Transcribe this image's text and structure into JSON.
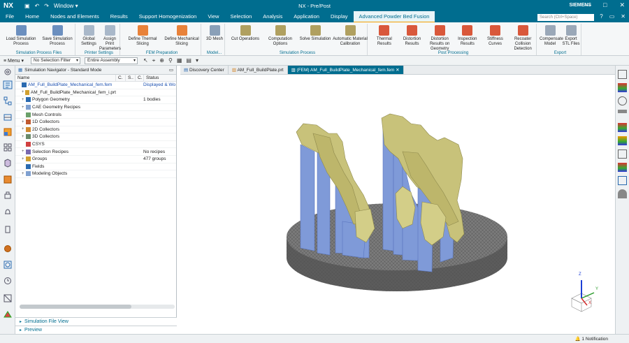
{
  "app": {
    "logo": "NX",
    "title": "NX - Pre/Post",
    "window_menu": "Window",
    "brand": "SIEMENS"
  },
  "menu": {
    "items": [
      "File",
      "Home",
      "Nodes and Elements",
      "Results",
      "Support Homogenization",
      "View",
      "Selection",
      "Analysis",
      "Application",
      "Display",
      "Advanced Powder Bed Fusion"
    ],
    "search_placeholder": "Search (Ctrl+Space)"
  },
  "ribbon": {
    "groups": [
      {
        "label": "Simulation Process Files",
        "buttons": [
          "Load Simulation Process",
          "Save Simulation Process"
        ]
      },
      {
        "label": "Printer Settings",
        "buttons": [
          "Global Settings",
          "Assign Print Parameters"
        ]
      },
      {
        "label": "FEM Preparation",
        "buttons": [
          "Define Thermal Slicing",
          "Define Mechanical Slicing"
        ]
      },
      {
        "label": "Model...",
        "buttons": [
          "3D Mesh"
        ]
      },
      {
        "label": "Simulation Process",
        "buttons": [
          "Cut Operations",
          "Computation Options",
          "Solve Simulation",
          "Automatic Material Calibration"
        ]
      },
      {
        "label": "Post Processing",
        "buttons": [
          "Thermal Results",
          "Distortion Results",
          "Distortion Results on Geometry",
          "Inspection Results",
          "Stiffness Curves",
          "Recoater Collision Detection"
        ]
      },
      {
        "label": "Export",
        "buttons": [
          "Compensate Model",
          "Export STL Files"
        ]
      }
    ]
  },
  "toolbar": {
    "menu_label": "Menu",
    "selection_filter": "No Selection Filter",
    "scope": "Entire Assembly"
  },
  "navigator": {
    "title": "Simulation Navigator - Standard Mode",
    "columns": {
      "name": "Name",
      "c1": "C.",
      "c2": "S..",
      "c3": "C.",
      "status": "Status"
    },
    "rows": [
      {
        "name": "AM_Full_BuildPlate_Mechanical_fem.fem",
        "status": "Displayed & Wo",
        "link": true
      },
      {
        "name": "AM_Full_BuildPlate_Mechanical_fem_i.prt",
        "status": ""
      },
      {
        "name": "Polygon Geometry",
        "status": "1 bodies"
      },
      {
        "name": "CAE Geometry Recipes",
        "status": ""
      },
      {
        "name": "Mesh Controls",
        "status": ""
      },
      {
        "name": "1D Collectors",
        "status": ""
      },
      {
        "name": "2D Collectors",
        "status": ""
      },
      {
        "name": "3D Collectors",
        "status": ""
      },
      {
        "name": "CSYS",
        "status": ""
      },
      {
        "name": "Selection Recipes",
        "status": "No recipes"
      },
      {
        "name": "Groups",
        "status": "477 groups"
      },
      {
        "name": "Fields",
        "status": ""
      },
      {
        "name": "Modeling Objects",
        "status": ""
      }
    ],
    "bottom_sections": [
      "Simulation File View",
      "Preview"
    ]
  },
  "tabs": [
    "Discovery Center",
    "AM_Full_BuildPlate.prt",
    "(FEM) AM_Full_BuildPlate_Mechanical_fem.fem"
  ],
  "status": {
    "notification": "1 Notification"
  },
  "colors": {
    "accent": "#006d8f",
    "highlight": "#f4a000",
    "support": "#7f9ad8",
    "part": "#c8c27a",
    "plate": "#6b6b6b"
  }
}
